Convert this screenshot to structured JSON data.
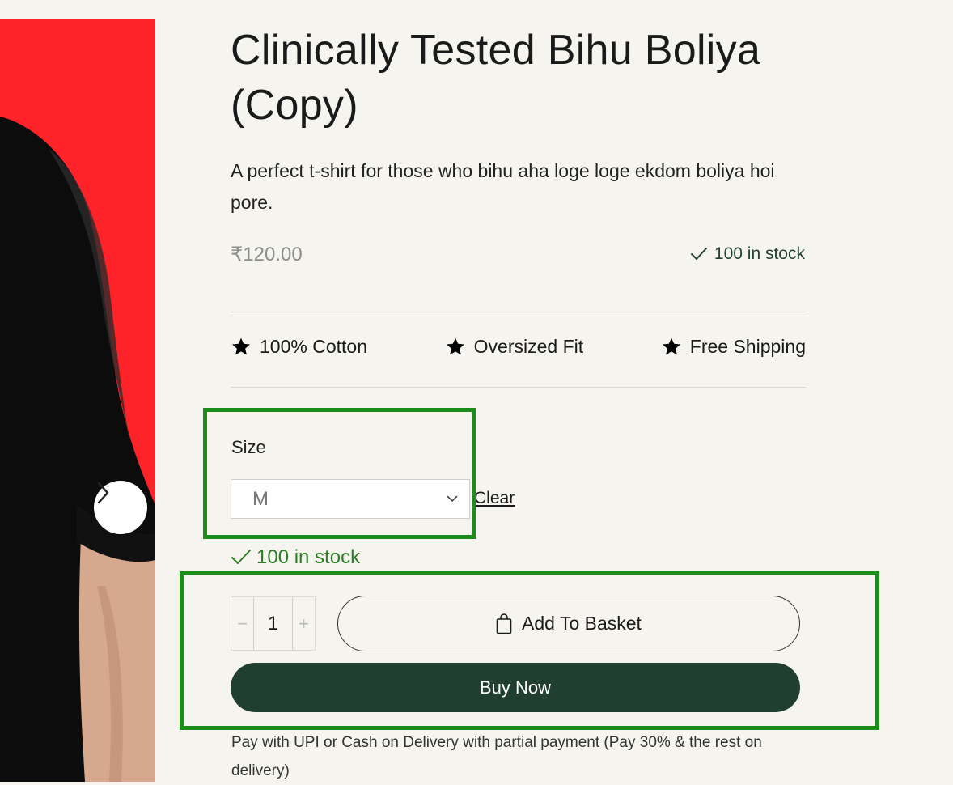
{
  "product": {
    "title": "Clinically Tested Bihu Boliya (Copy)",
    "description": "A perfect t-shirt for those who bihu aha loge loge ekdom boliya hoi pore.",
    "price": "₹120.00",
    "stock_summary": "100 in stock"
  },
  "features": [
    {
      "label": "100% Cotton",
      "icon": "star-icon"
    },
    {
      "label": "Oversized Fit",
      "icon": "star-icon"
    },
    {
      "label": "Free Shipping",
      "icon": "star-icon"
    }
  ],
  "variant": {
    "size_label": "Size",
    "size_value": "M",
    "clear_label": "Clear",
    "stock": "100 in stock"
  },
  "cart": {
    "quantity": "1",
    "minus": "−",
    "plus": "+",
    "add_label": "Add To Basket",
    "buy_label": "Buy Now"
  },
  "payment_note": "Pay with UPI or Cash on Delivery with partial payment (Pay 30% & the rest on delivery)",
  "colors": {
    "background": "#f5f4ee",
    "image_bg": "#fe2229",
    "primary": "#213f31",
    "in_stock": "#2f7d27",
    "highlight": "#1c8c1a"
  }
}
